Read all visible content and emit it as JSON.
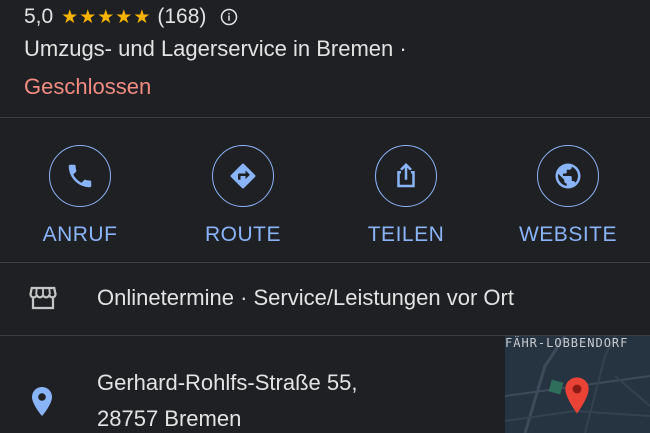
{
  "rating": {
    "value": "5,0",
    "stars": "★★★★★",
    "count": "(168)"
  },
  "business": {
    "category_line": "Umzugs- und Lagerservice in Bremen ·",
    "status": "Geschlossen"
  },
  "actions": [
    {
      "label": "ANRUF",
      "icon": "phone-icon"
    },
    {
      "label": "ROUTE",
      "icon": "directions-icon"
    },
    {
      "label": "TEILEN",
      "icon": "share-icon"
    },
    {
      "label": "WEBSITE",
      "icon": "globe-icon"
    }
  ],
  "services": {
    "icon": "storefront-icon",
    "text": "Onlinetermine · Service/Leistungen vor Ort"
  },
  "address": {
    "icon": "location-pin-icon",
    "line1": "Gerhard-Rohlfs-Straße 55,",
    "line2": "28757 Bremen"
  },
  "map": {
    "label": "FÄHR-LOBBENDORF"
  },
  "colors": {
    "background": "#1f2024",
    "accent": "#8ab4f8",
    "star": "#f6b400",
    "closed": "#f28b82",
    "map_pin": "#ea4335"
  }
}
